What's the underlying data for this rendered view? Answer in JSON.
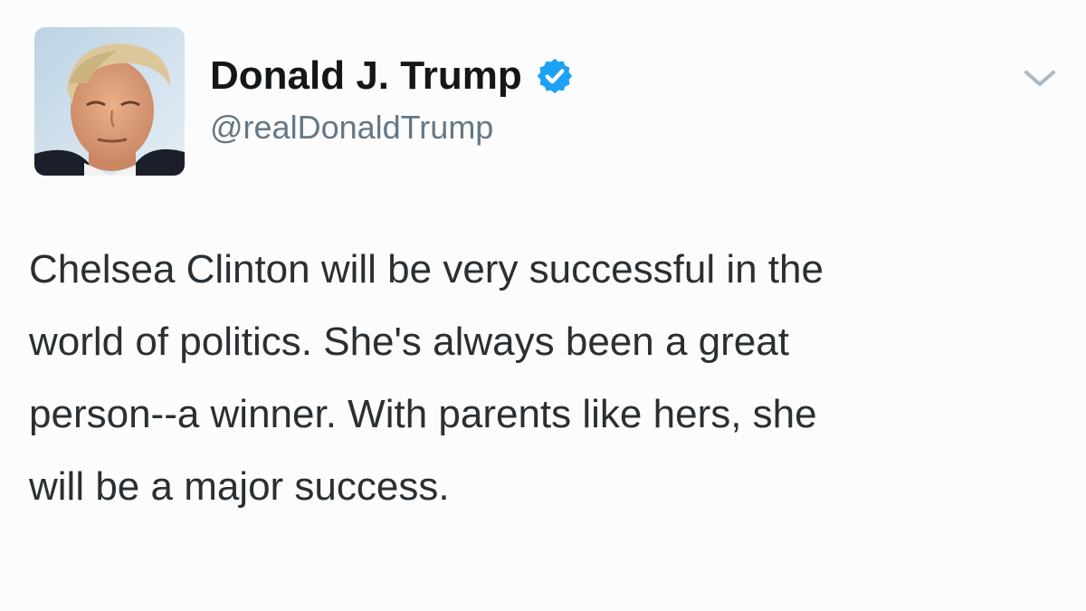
{
  "tweet": {
    "author": {
      "display_name": "Donald J. Trump",
      "handle": "@realDonaldTrump",
      "verified": true,
      "avatar_icon": "profile-photo"
    },
    "text": "Chelsea Clinton will be very successful in the\nworld of politics. She's always been a great\nperson--a winner. With parents like hers, she\nwill be a major success.",
    "menu_icon": "chevron-down-icon"
  },
  "colors": {
    "background": "#fcfcfc",
    "name": "#14171a",
    "handle": "#657786",
    "text": "#292f33",
    "verified": "#1da1f2",
    "caret": "#aab8c2"
  }
}
